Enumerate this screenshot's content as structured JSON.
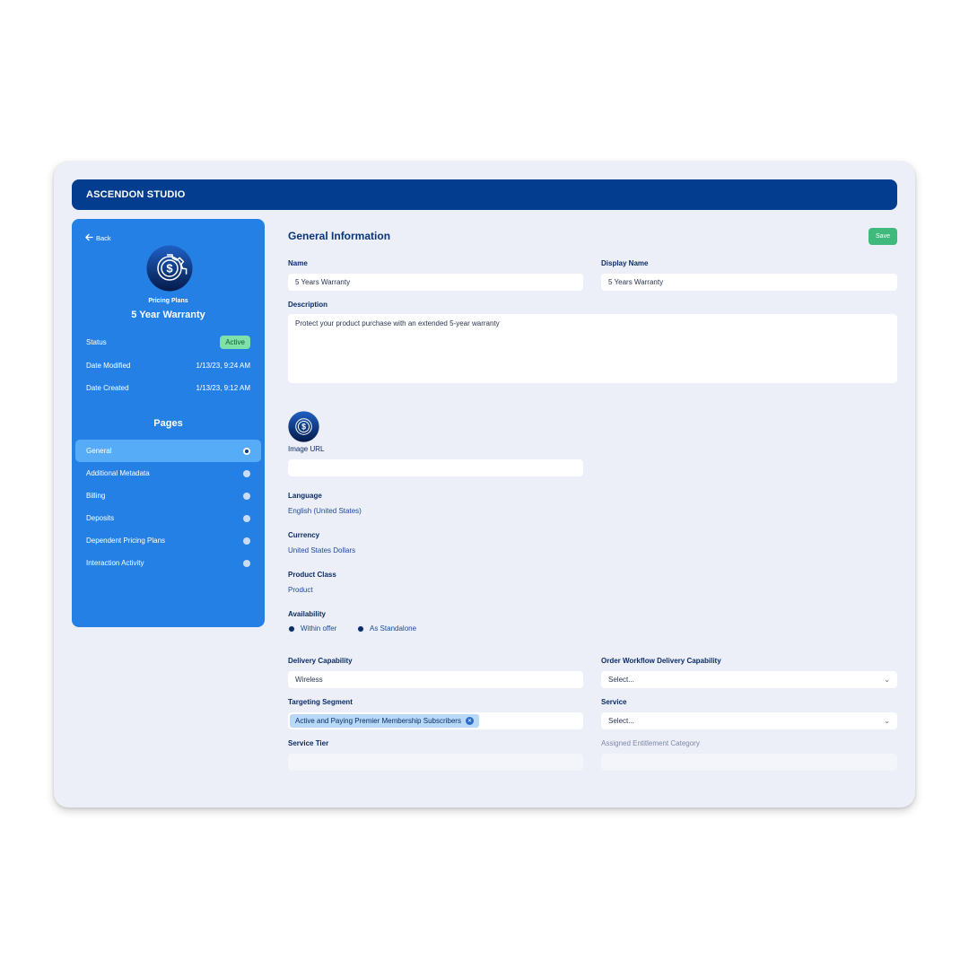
{
  "app": {
    "title": "ASCENDON STUDIO"
  },
  "sidebar": {
    "back_label": "Back",
    "entity_type": "Pricing Plans",
    "entity_name": "5 Year Warranty",
    "status_label": "Status",
    "status_value": "Active",
    "date_modified_label": "Date Modified",
    "date_modified_value": "1/13/23, 9:24 AM",
    "date_created_label": "Date Created",
    "date_created_value": "1/13/23, 9:12 AM",
    "pages_title": "Pages",
    "pages": [
      {
        "label": "General",
        "active": true
      },
      {
        "label": "Additional Metadata",
        "active": false
      },
      {
        "label": "Billing",
        "active": false
      },
      {
        "label": "Deposits",
        "active": false
      },
      {
        "label": "Dependent Pricing Plans",
        "active": false
      },
      {
        "label": "Interaction Activity",
        "active": false
      }
    ]
  },
  "main": {
    "title": "General Information",
    "save_label": "Save",
    "name_label": "Name",
    "name_value": "5 Years Warranty",
    "display_name_label": "Display Name",
    "display_name_value": "5 Years Warranty",
    "description_label": "Description",
    "description_value": "Protect your product purchase with an extended 5-year warranty",
    "image_url_label": "Image URL",
    "image_url_value": "",
    "language_label": "Language",
    "language_value": "English (United States)",
    "currency_label": "Currency",
    "currency_value": "United States Dollars",
    "product_class_label": "Product Class",
    "product_class_value": "Product",
    "availability_label": "Availability",
    "availability_options": [
      "Within offer",
      "As Standalone"
    ],
    "delivery_capability_label": "Delivery Capability",
    "delivery_capability_value": "Wireless",
    "order_workflow_label": "Order Workflow Delivery Capability",
    "order_workflow_value": "Select...",
    "targeting_segment_label": "Targeting Segment",
    "targeting_segment_chip": "Active and Paying Premier Membership Subscribers",
    "service_label": "Service",
    "service_value": "Select...",
    "service_tier_label": "Service Tier",
    "assigned_entitlement_label": "Assigned Entitlement Category"
  },
  "colors": {
    "brand_dark": "#033d8f",
    "sidebar_blue": "#2580e6",
    "active_item": "#57acf7",
    "status_active": "#7ee1a8",
    "save_green": "#3fb97c"
  },
  "icons": [
    "arrow-left-icon",
    "dollar-gear-icon",
    "chevron-down-icon",
    "close-icon"
  ]
}
